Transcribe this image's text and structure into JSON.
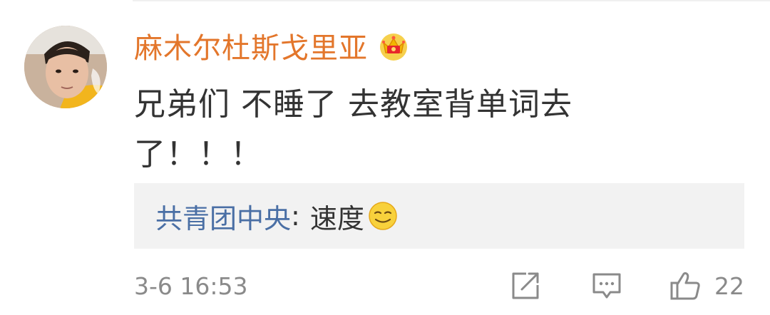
{
  "comment": {
    "username": "麻木尔杜斯戈里亚",
    "text": "兄弟们 不睡了 去教室背单词去了！！！",
    "timestamp": "3-6 16:53",
    "like_count": "22"
  },
  "reply": {
    "author": "共青团中央",
    "separator": ":",
    "text": "速度"
  },
  "icons": {
    "badge": "vip-crown-icon",
    "reply_emoji": "smirk-emoji-icon",
    "share": "share-icon",
    "comment": "comment-icon",
    "like": "thumbs-up-icon"
  },
  "colors": {
    "username": "#e3762b",
    "reply_author": "#4a6fa5",
    "muted": "#8a8a8a",
    "reply_background": "#f2f2f2"
  }
}
